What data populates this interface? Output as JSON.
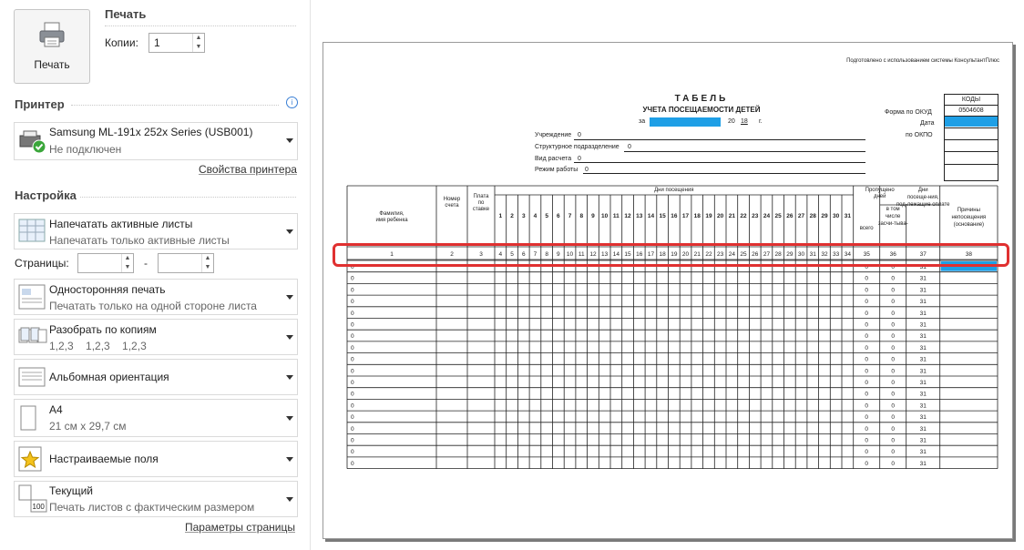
{
  "print": {
    "button_label": "Печать",
    "section_title": "Печать",
    "copies_label": "Копии:",
    "copies_value": "1"
  },
  "printer": {
    "section_title": "Принтер",
    "name": "Samsung ML-191x 252x Series (USB001)",
    "status": "Не подключен",
    "properties_link": "Свойства принтера"
  },
  "settings": {
    "section_title": "Настройка",
    "what": {
      "title": "Напечатать активные листы",
      "subtitle": "Напечатать только активные листы"
    },
    "pages_label": "Страницы:",
    "pages_dash": "-",
    "pages_from": "",
    "pages_to": "",
    "sides": {
      "title": "Односторонняя печать",
      "subtitle": "Печатать только на одной стороне листа"
    },
    "collate": {
      "title": "Разобрать по копиям",
      "subtitle": "1,2,3    1,2,3    1,2,3"
    },
    "orientation": {
      "title": "Альбомная ориентация"
    },
    "paper": {
      "title": "A4",
      "subtitle": "21 см x 29,7 см"
    },
    "margins": {
      "title": "Настраиваемые поля"
    },
    "scaling": {
      "title": "Текущий",
      "subtitle": "Печать листов с фактическим размером",
      "icon_text": "100"
    },
    "page_setup_link": "Параметры страницы"
  },
  "sheet": {
    "header_note": "Подготовлено с использованием системы КонсультантПлюс",
    "title": "ТАБЕЛЬ",
    "subtitle": "УЧЕТА ПОСЕЩАЕМОСТИ ДЕТЕЙ",
    "period_prefix": "за",
    "year_prefix": "20",
    "year": "18",
    "year_suffix": "г.",
    "fields": [
      {
        "label": "Учреждение",
        "value": "0"
      },
      {
        "label": "Структурное подразделение",
        "value": "0"
      },
      {
        "label": "Вид расчета",
        "value": "0"
      },
      {
        "label": "Режим работы",
        "value": "0"
      }
    ],
    "codes": {
      "header": "КОДЫ",
      "okud_label": "Форма по ОКУД",
      "okud_value": "0504608",
      "date_label": "Дата",
      "okpo_label": "по ОКПО"
    },
    "columns": {
      "name": "Фамилия, имя ребенка",
      "account": "Номер счета",
      "fee": "Плата по ставке",
      "days_group": "Дни посещения",
      "missed_group": "Пропущено дней",
      "missed_total": "всего",
      "missed_counted": "в том числе засчи-тыва-",
      "paid_days": "Дни посеще-ния, под-лежащие оплате",
      "reasons": "Причины непосещения (основание)"
    },
    "days": [
      "1",
      "2",
      "3",
      "4",
      "5",
      "6",
      "7",
      "8",
      "9",
      "10",
      "11",
      "12",
      "13",
      "14",
      "15",
      "16",
      "17",
      "18",
      "19",
      "20",
      "21",
      "22",
      "23",
      "24",
      "25",
      "26",
      "27",
      "28",
      "29",
      "30",
      "31"
    ],
    "numbering": [
      "1",
      "2",
      "3",
      "4",
      "5",
      "6",
      "7",
      "8",
      "9",
      "10",
      "11",
      "12",
      "13",
      "14",
      "15",
      "16",
      "17",
      "18",
      "19",
      "20",
      "21",
      "22",
      "23",
      "24",
      "25",
      "26",
      "27",
      "28",
      "29",
      "30",
      "31",
      "32",
      "33",
      "34",
      "35",
      "36",
      "37",
      "38"
    ],
    "row_values": {
      "name": "0",
      "missed_total": "0",
      "missed_counted": "0",
      "paid": "31"
    },
    "row_count": 18
  },
  "colors": {
    "accent_blue": "#1e9fe6",
    "highlight": "#e03030"
  }
}
